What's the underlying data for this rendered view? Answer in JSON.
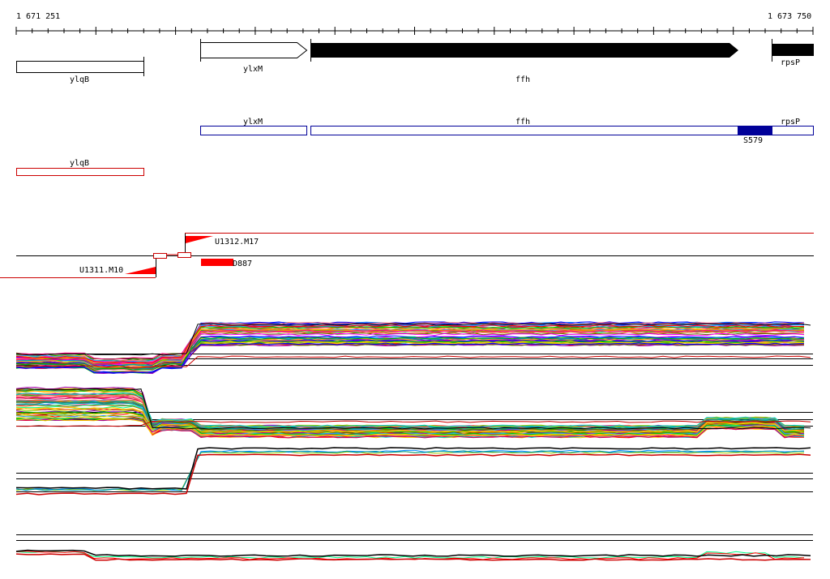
{
  "ruler": {
    "start_label": "1 671 251",
    "end_label": "1 673 750"
  },
  "genes": {
    "ylqB": "ylqB",
    "ylxM": "ylxM",
    "ffh": "ffh",
    "rpsP": "rpsP"
  },
  "feature_label": "S579",
  "probes": {
    "m17": "U1312.M17",
    "m10": "U1311.M10",
    "d887": "D887"
  },
  "colors": {
    "gene_fill": "#000000",
    "annotation_blue": "#000099",
    "ylqB_track": "#cc0000",
    "probe_red": "#ff0000"
  }
}
